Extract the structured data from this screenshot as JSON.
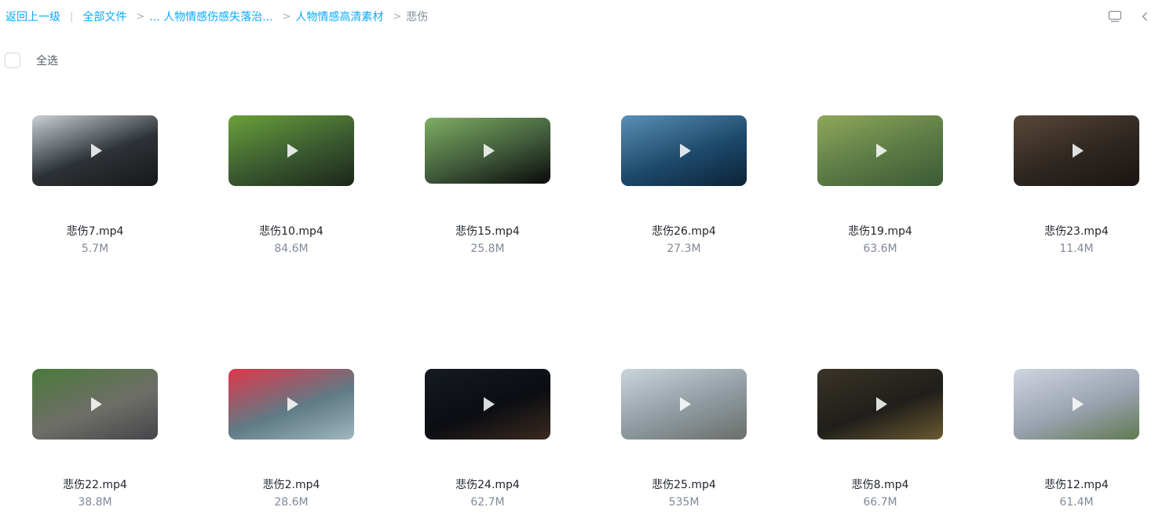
{
  "breadcrumb": {
    "back": "返回上一级",
    "root": "全部文件",
    "parent_truncated": "... 人物情感伤感失落治...",
    "parent": "人物情感高清素材",
    "current": "悲伤",
    "separator": ">"
  },
  "toolbar": {
    "view_icon": "screen-icon",
    "collapse_icon": "chevron-left-icon"
  },
  "select_all": {
    "label": "全选",
    "checked": false
  },
  "files": [
    {
      "name": "悲伤7.mp4",
      "size": "5.7M",
      "thumb_colors": [
        "#c9d0d6",
        "#2d3236",
        "#15181b"
      ]
    },
    {
      "name": "悲伤10.mp4",
      "size": "84.6M",
      "thumb_colors": [
        "#6aa03a",
        "#3a5a30",
        "#1b2618"
      ]
    },
    {
      "name": "悲伤15.mp4",
      "size": "25.8M",
      "thumb_colors": [
        "#7fae62",
        "#3f5a3a",
        "#0a0a0a"
      ]
    },
    {
      "name": "悲伤26.mp4",
      "size": "27.3M",
      "thumb_colors": [
        "#5a8fb6",
        "#1d4a6c",
        "#0d2236"
      ]
    },
    {
      "name": "悲伤19.mp4",
      "size": "63.6M",
      "thumb_colors": [
        "#8fa85a",
        "#5a7a45",
        "#3b5a35"
      ]
    },
    {
      "name": "悲伤23.mp4",
      "size": "11.4M",
      "thumb_colors": [
        "#5a4838",
        "#2e2620",
        "#1a1512"
      ]
    },
    {
      "name": "悲伤22.mp4",
      "size": "38.8M",
      "thumb_colors": [
        "#4a7a3a",
        "#6f6e68",
        "#45464a"
      ]
    },
    {
      "name": "悲伤2.mp4",
      "size": "28.6M",
      "thumb_colors": [
        "#e0364a",
        "#5f7b86",
        "#9fb6be"
      ]
    },
    {
      "name": "悲伤24.mp4",
      "size": "62.7M",
      "thumb_colors": [
        "#151a22",
        "#0b0d12",
        "#3a2a20"
      ]
    },
    {
      "name": "悲伤25.mp4",
      "size": "535M",
      "thumb_colors": [
        "#c9d6dc",
        "#8f9aa0",
        "#6a6e6a"
      ]
    },
    {
      "name": "悲伤8.mp4",
      "size": "66.7M",
      "thumb_colors": [
        "#3a3428",
        "#1f1e1a",
        "#6a5a30"
      ]
    },
    {
      "name": "悲伤12.mp4",
      "size": "61.4M",
      "thumb_colors": [
        "#d0d6e0",
        "#9aa2b0",
        "#5f7a50"
      ]
    }
  ]
}
